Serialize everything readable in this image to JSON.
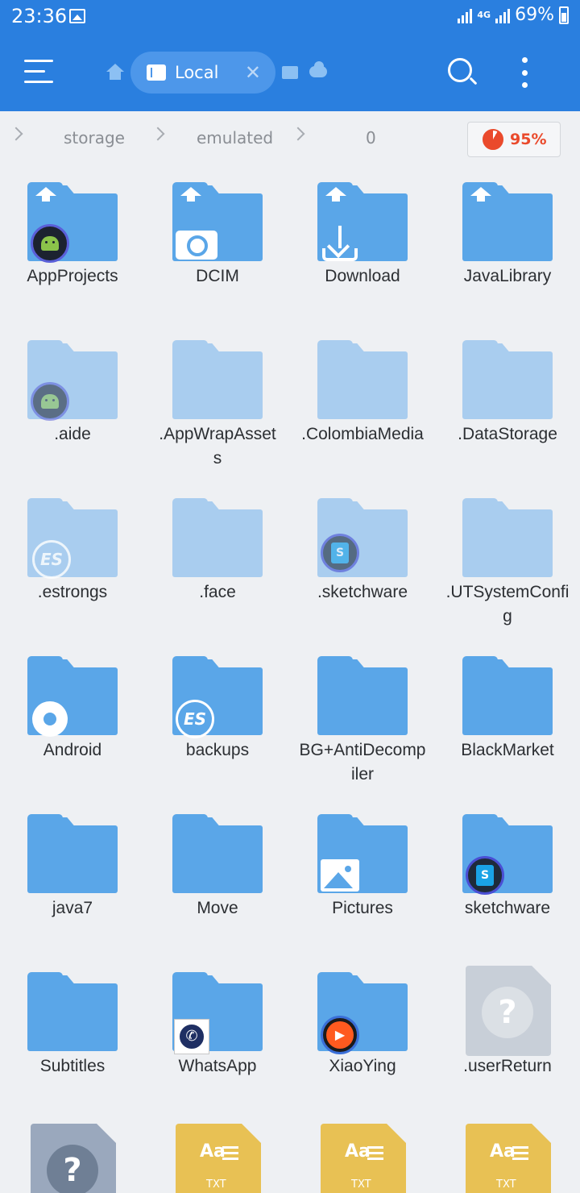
{
  "status_bar": {
    "time": "23:36",
    "network": "4G",
    "battery": "69%"
  },
  "toolbar": {
    "tab_label": "Local",
    "close_glyph": "✕"
  },
  "breadcrumb": {
    "items": [
      "storage",
      "emulated",
      "0"
    ],
    "storage_usage": "95%"
  },
  "colors": {
    "accent": "#2a7fdf",
    "folder": "#5aa6e8",
    "folder_hidden": "#a9cdef",
    "usage_alert": "#ea4a2c",
    "text_file": "#e8c154"
  },
  "files": [
    {
      "name": "AppProjects",
      "kind": "folder",
      "overlay": "upload-arrow",
      "badge": "android-ide-icon"
    },
    {
      "name": "DCIM",
      "kind": "folder",
      "overlay": "upload-arrow",
      "badge": "camera-icon"
    },
    {
      "name": "Download",
      "kind": "folder",
      "overlay": "upload-arrow",
      "badge": "download-icon"
    },
    {
      "name": "JavaLibrary",
      "kind": "folder",
      "overlay": "upload-arrow"
    },
    {
      "name": ".aide",
      "kind": "folder-hidden",
      "badge": "android-ide-icon"
    },
    {
      "name": ".AppWrapAssets",
      "kind": "folder-hidden"
    },
    {
      "name": ".ColombiaMedia",
      "kind": "folder-hidden"
    },
    {
      "name": ".DataStorage",
      "kind": "folder-hidden"
    },
    {
      "name": ".estrongs",
      "kind": "folder-hidden",
      "badge": "es-icon"
    },
    {
      "name": ".face",
      "kind": "folder-hidden"
    },
    {
      "name": ".sketchware",
      "kind": "folder-hidden",
      "badge": "sketchware-icon"
    },
    {
      "name": ".UTSystemConfig",
      "kind": "folder-hidden"
    },
    {
      "name": "Android",
      "kind": "folder",
      "badge": "gear-icon"
    },
    {
      "name": "backups",
      "kind": "folder",
      "badge": "es-icon"
    },
    {
      "name": "BG+AntiDecompiler",
      "kind": "folder"
    },
    {
      "name": "BlackMarket",
      "kind": "folder"
    },
    {
      "name": "java7",
      "kind": "folder"
    },
    {
      "name": "Move",
      "kind": "folder"
    },
    {
      "name": "Pictures",
      "kind": "folder",
      "badge": "picture-icon"
    },
    {
      "name": "sketchware",
      "kind": "folder",
      "badge": "sketchware-icon"
    },
    {
      "name": "Subtitles",
      "kind": "folder"
    },
    {
      "name": "WhatsApp",
      "kind": "folder",
      "badge": "whatsapp-icon"
    },
    {
      "name": "XiaoYing",
      "kind": "folder",
      "badge": "xiaoying-icon"
    },
    {
      "name": ".userReturn",
      "kind": "file-unknown"
    }
  ],
  "partial_row": [
    {
      "kind": "file-unknown-dark",
      "glyph": "?"
    },
    {
      "kind": "file-txt",
      "glyph": "Aa",
      "type_label": "TXT"
    },
    {
      "kind": "file-txt",
      "glyph": "Aa",
      "type_label": "TXT"
    },
    {
      "kind": "file-txt",
      "glyph": "Aa",
      "type_label": "TXT"
    }
  ]
}
